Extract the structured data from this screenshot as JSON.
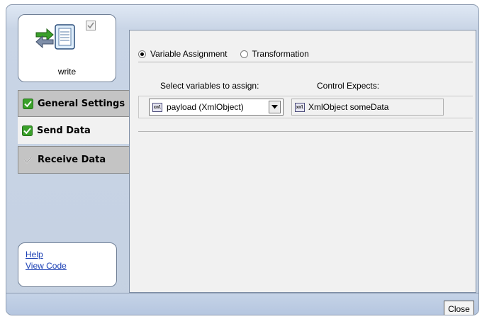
{
  "action": {
    "name": "write",
    "icons": [
      "exchange-arrows-icon",
      "document-icon",
      "checked-box-icon"
    ]
  },
  "nav": {
    "items": [
      {
        "label": "General Settings",
        "checked": true
      },
      {
        "label": "Send Data",
        "checked": true
      },
      {
        "label": "Receive Data",
        "checked": false
      }
    ]
  },
  "links": {
    "help": "Help",
    "view_code": "View Code"
  },
  "mode": {
    "options": [
      "Variable Assignment",
      "Transformation"
    ],
    "selected": "Variable Assignment"
  },
  "assign": {
    "select_header": "Select variables to assign:",
    "expects_header": "Control Expects:",
    "selected_variable": "payload (XmlObject)",
    "expected_type": "XmlObject someData",
    "type_icon_text": "xml"
  },
  "footer": {
    "close_label": "Close"
  },
  "colors": {
    "check_green": "#3aa02a",
    "link_blue": "#1a3fb4",
    "frame_blue": "#c9d5e6"
  }
}
